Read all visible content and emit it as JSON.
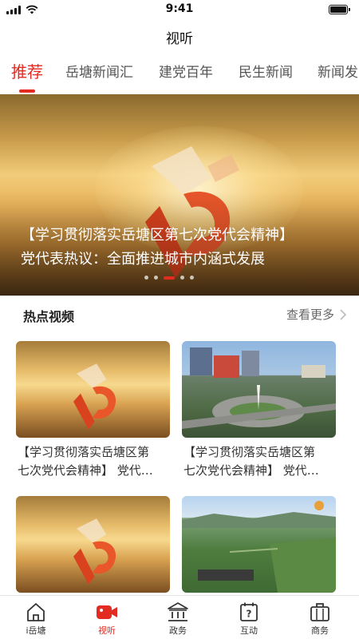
{
  "status_bar": {
    "time": "9:41"
  },
  "header": {
    "title": "视听"
  },
  "tabs": [
    {
      "label": "推荐",
      "active": true
    },
    {
      "label": "岳塘新闻汇"
    },
    {
      "label": "建党百年"
    },
    {
      "label": "民生新闻"
    },
    {
      "label": "新闻发"
    }
  ],
  "banner": {
    "caption_line1": "【学习贯彻落实岳塘区第七次党代会精神】",
    "caption_line2": "党代表热议：全面推进城市内涵式发展",
    "slide_count": 5,
    "active_slide": 3
  },
  "hot_videos": {
    "title": "热点视频",
    "more_label": "查看更多",
    "items": [
      {
        "title_line1": "【学习贯彻落实岳塘区第",
        "title_line2": "七次党代会精神】 党代…",
        "thumb": "golden-sky-emblem"
      },
      {
        "title_line1": "【学习贯彻落实岳塘区第",
        "title_line2": "七次党代会精神】 党代…",
        "thumb": "city-roundabout"
      },
      {
        "title_line1": "",
        "title_line2": "",
        "thumb": "golden-sky-emblem"
      },
      {
        "title_line1": "",
        "title_line2": "",
        "thumb": "green-farmland"
      }
    ]
  },
  "bottom_nav": [
    {
      "label": "i岳塘",
      "icon": "home-icon"
    },
    {
      "label": "视听",
      "icon": "video-camera-icon",
      "active": true
    },
    {
      "label": "政务",
      "icon": "government-building-icon"
    },
    {
      "label": "互动",
      "icon": "interaction-question-icon"
    },
    {
      "label": "商务",
      "icon": "briefcase-icon"
    }
  ],
  "colors": {
    "accent": "#e32b22",
    "text": "#222222",
    "muted": "#666666"
  }
}
